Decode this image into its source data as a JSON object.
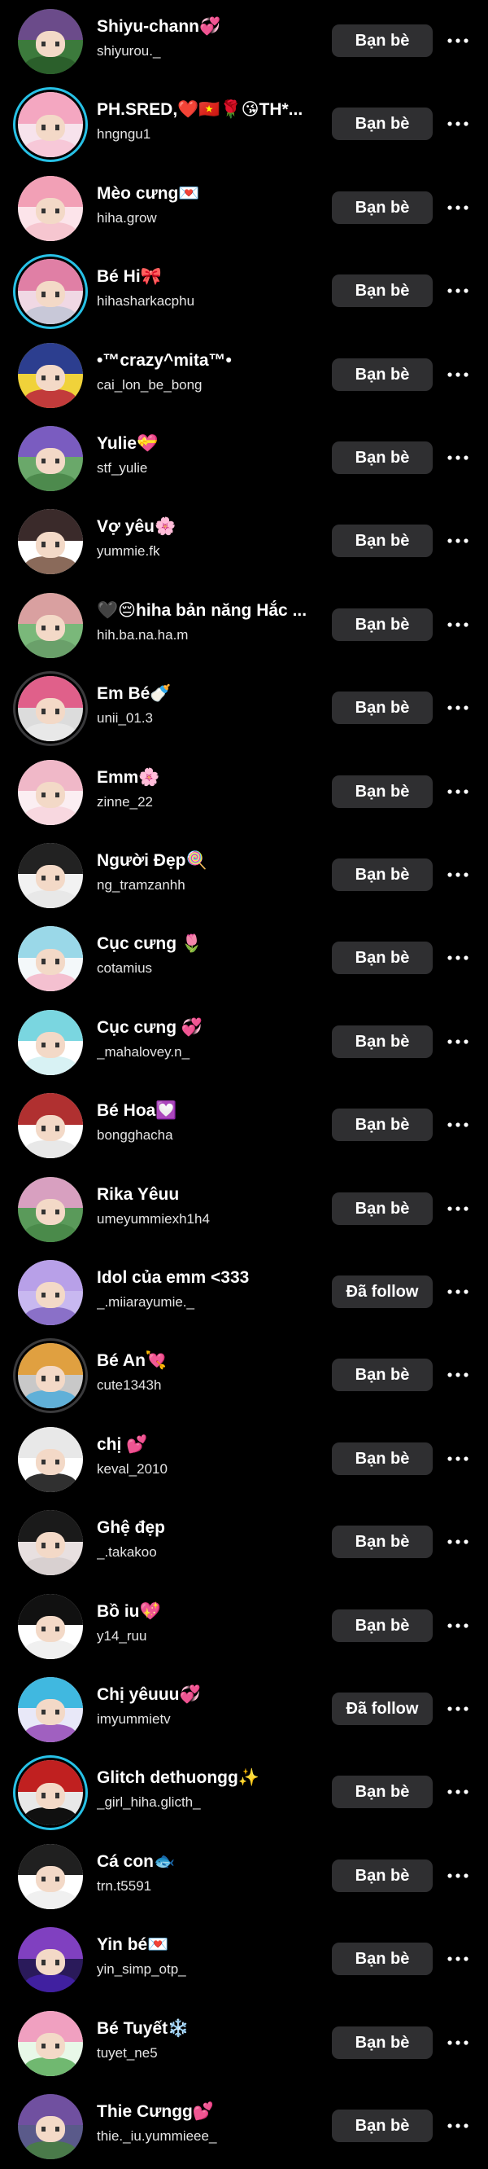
{
  "friends": [
    {
      "name": "Shiyu-chann💞",
      "handle": "shiyurou._",
      "button": "Bạn bè",
      "ring": "none",
      "hair": "#6b4b8a",
      "body": "#2b5f2b",
      "bg": "#3c7a3c"
    },
    {
      "name": "PH.SRED,❤️🇻🇳🌹😘TH*...",
      "handle": "hngngu1",
      "button": "Bạn bè",
      "ring": "blue",
      "hair": "#f4a7c1",
      "body": "#f7c8d8",
      "bg": "#f7e3ec"
    },
    {
      "name": "Mèo cưng💌",
      "handle": "hiha.grow",
      "button": "Bạn bè",
      "ring": "none",
      "hair": "#f2a0b6",
      "body": "#f6c6d0",
      "bg": "#fce4ea"
    },
    {
      "name": "Bé Hi🎀",
      "handle": "hihasharkacphu",
      "button": "Bạn bè",
      "ring": "blue",
      "hair": "#e07fa5",
      "body": "#c8c8d8",
      "bg": "#f0d8e4"
    },
    {
      "name": "•™crazy^mita™•",
      "handle": "cai_lon_be_bong",
      "button": "Bạn bè",
      "ring": "none",
      "hair": "#2c3e8f",
      "body": "#c23b3b",
      "bg": "#f0d23a"
    },
    {
      "name": "Yulie💝",
      "handle": "stf_yulie",
      "button": "Bạn bè",
      "ring": "none",
      "hair": "#7a5cc0",
      "body": "#4d8a4d",
      "bg": "#6aa86a"
    },
    {
      "name": "Vợ yêu🌸",
      "handle": "yummie.fk",
      "button": "Bạn bè",
      "ring": "none",
      "hair": "#3a2a2a",
      "body": "#8a6a5a",
      "bg": "#ffffff"
    },
    {
      "name": "🖤😔hiha bản năng Hắc ...",
      "handle": "hih.ba.na.ha.m",
      "button": "Bạn bè",
      "ring": "none",
      "hair": "#d9a0a0",
      "body": "#6aa06a",
      "bg": "#7ab87a"
    },
    {
      "name": "Em Bé🍼",
      "handle": "unii_01.3",
      "button": "Bạn bè",
      "ring": "gray",
      "hair": "#e0608a",
      "body": "#e8e8e8",
      "bg": "#dcdcdc"
    },
    {
      "name": "Emm🌸",
      "handle": "zinne_22",
      "button": "Bạn bè",
      "ring": "none",
      "hair": "#f0b8c8",
      "body": "#f8d8e0",
      "bg": "#fbeef2"
    },
    {
      "name": "Người Đẹp🍭",
      "handle": "ng_tramzanhh",
      "button": "Bạn bè",
      "ring": "none",
      "hair": "#222222",
      "body": "#e8e8e8",
      "bg": "#f2f2f2"
    },
    {
      "name": "Cục cưng 🌷",
      "handle": "cotamius",
      "button": "Bạn bè",
      "ring": "none",
      "hair": "#9ad8e8",
      "body": "#f4c0d0",
      "bg": "#f4f8fa"
    },
    {
      "name": "Cục cưng 💞",
      "handle": "_mahalovey.n_",
      "button": "Bạn bè",
      "ring": "none",
      "hair": "#7ad6e0",
      "body": "#d8f2f4",
      "bg": "#ffffff"
    },
    {
      "name": "Bé Hoa💟",
      "handle": "bongghacha",
      "button": "Bạn bè",
      "ring": "none",
      "hair": "#b03030",
      "body": "#e8e8e8",
      "bg": "#ffffff"
    },
    {
      "name": "Rika Yêuu",
      "handle": "umeyummiexh1h4",
      "button": "Bạn bè",
      "ring": "none",
      "hair": "#d8a0c0",
      "body": "#4a8a4a",
      "bg": "#5a9a5a"
    },
    {
      "name": "Idol của emm <333",
      "handle": "_.miiarayumie._",
      "button": "Đã follow",
      "ring": "none",
      "hair": "#b8a0e8",
      "body": "#8a70c8",
      "bg": "#c8b8f0"
    },
    {
      "name": "Bé An💘",
      "handle": "cute1343h",
      "button": "Bạn bè",
      "ring": "gray",
      "hair": "#e0a040",
      "body": "#60b0d8",
      "bg": "#c8c8c8"
    },
    {
      "name": "chị 💕",
      "handle": "keval_2010",
      "button": "Bạn bè",
      "ring": "none",
      "hair": "#e8e8e8",
      "body": "#303030",
      "bg": "#ffffff"
    },
    {
      "name": "Ghệ đẹp",
      "handle": "_.takakoo",
      "button": "Bạn bè",
      "ring": "none",
      "hair": "#1a1a1a",
      "body": "#d8d0d0",
      "bg": "#e8e0e0"
    },
    {
      "name": "Bồ iu💖",
      "handle": "y14_ruu",
      "button": "Bạn bè",
      "ring": "none",
      "hair": "#111111",
      "body": "#f0f0f0",
      "bg": "#ffffff"
    },
    {
      "name": "Chị yêuuu💞",
      "handle": "imyummietv",
      "button": "Đã follow",
      "ring": "none",
      "hair": "#40b8e0",
      "body": "#a060c0",
      "bg": "#e8e8f8"
    },
    {
      "name": "Glitch dethuongg✨",
      "handle": "_girl_hiha.glicth_",
      "button": "Bạn bè",
      "ring": "blue",
      "hair": "#c02020",
      "body": "#101010",
      "bg": "#e8e8e8"
    },
    {
      "name": "Cá con🐟",
      "handle": "trn.t5591",
      "button": "Bạn bè",
      "ring": "none",
      "hair": "#202020",
      "body": "#f0f0f0",
      "bg": "#ffffff"
    },
    {
      "name": "Yin bé💌",
      "handle": "yin_simp_otp_",
      "button": "Bạn bè",
      "ring": "none",
      "hair": "#8040c0",
      "body": "#4020a0",
      "bg": "#2a1a5a"
    },
    {
      "name": "Bé Tuyết❄️",
      "handle": "tuyet_ne5",
      "button": "Bạn bè",
      "ring": "none",
      "hair": "#f0a0c0",
      "body": "#70b870",
      "bg": "#e8f8e8"
    },
    {
      "name": "Thie Cưngg💕",
      "handle": "thie._iu.yummieee_",
      "button": "Bạn bè",
      "ring": "none",
      "hair": "#7050a0",
      "body": "#4a7a4a",
      "bg": "#5a5a8a"
    }
  ],
  "icons": {
    "more": "more-horizontal-icon"
  },
  "colors": {
    "background": "#000000",
    "button": "#2f2f31",
    "ring_blue": "#27c1e6"
  }
}
